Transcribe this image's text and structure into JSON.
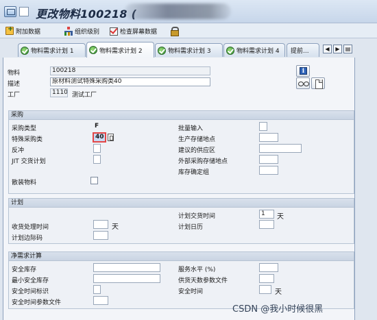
{
  "window": {
    "title": "更改物料100218 (",
    "title_icon": "material-master-icon"
  },
  "toolbar": {
    "items": [
      {
        "label": "附加数据",
        "icon": "add-data-icon"
      },
      {
        "label": "组织级别",
        "icon": "org-levels-icon"
      },
      {
        "label": "检查屏幕数据",
        "icon": "check-screen-icon"
      },
      {
        "label": "",
        "icon": "lock-icon"
      }
    ]
  },
  "tabs": [
    {
      "label": "物料需求计划 1",
      "active": false
    },
    {
      "label": "物料需求计划 2",
      "active": true
    },
    {
      "label": "物料需求计划 3",
      "active": false
    },
    {
      "label": "物料需求计划 4",
      "active": false
    }
  ],
  "tab_more": "提前...",
  "header": {
    "material_label": "物料",
    "material_value": "100218",
    "desc_label": "描述",
    "desc_value": "原材料测试特殊采购类40",
    "plant_label": "工厂",
    "plant_value": "1110",
    "plant_name": "测试工厂"
  },
  "procurement": {
    "title": "采购",
    "proc_type_label": "采购类型",
    "proc_type_value": "F",
    "special_proc_label": "特殊采购类",
    "special_proc_value": "40",
    "backflush_label": "反冲",
    "jit_label": "JIT 交货计划",
    "bulk_label": "散装物料",
    "batch_entry_label": "批量输入",
    "prod_stor_label": "生产存储地点",
    "supply_area_label": "建议的供应区",
    "ext_stor_label": "外部采购存储地点",
    "stock_group_label": "库存确定组"
  },
  "scheduling": {
    "title": "计划",
    "gr_time_label": "收货处理时间",
    "gr_time_unit": "天",
    "sm_key_label": "计划边际码",
    "planned_delivery_label": "计划交货时间",
    "planned_delivery_value": "1",
    "planned_delivery_unit": "天",
    "planning_cal_label": "计划日历"
  },
  "net_req": {
    "title": "净需求计算",
    "safety_stock_label": "安全库存",
    "min_safety_label": "最小安全库存",
    "safety_time_ind_label": "安全时间标识",
    "safety_time_prof_label": "安全时间参数文件",
    "service_level_label": "服务水平 (%)",
    "cov_profile_label": "供货天数参数文件",
    "safety_time_label": "安全时间",
    "safety_time_unit": "天"
  },
  "watermark": "CSDN @我小时候很黑"
}
